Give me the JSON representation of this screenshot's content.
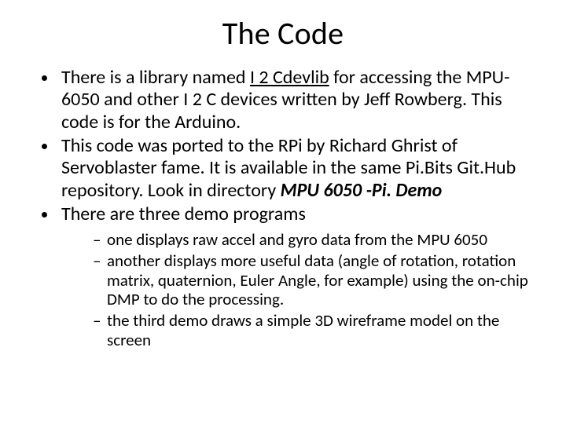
{
  "slide": {
    "title": "The Code",
    "bullets": [
      {
        "pre": "There is a library named ",
        "link": "I 2 Cdevlib",
        "post": " for accessing the MPU-6050 and other I 2 C devices written by Jeff Rowberg. This code is for the Arduino."
      },
      {
        "pre": "This code was ported to the RPi by Richard Ghrist of Servoblaster fame. It is available in the same Pi.Bits Git.Hub repository.  Look in directory ",
        "em": "MPU 6050 -Pi. Demo",
        "post": ""
      },
      {
        "pre": "There are three demo programs",
        "post": ""
      }
    ],
    "subbullets": [
      "one displays raw accel and gyro data from the MPU 6050",
      "another displays more useful data (angle of rotation, rotation matrix, quaternion, Euler Angle, for example) using the on-chip DMP to do the processing.",
      "the third demo draws a simple 3D wireframe model on the screen"
    ]
  }
}
